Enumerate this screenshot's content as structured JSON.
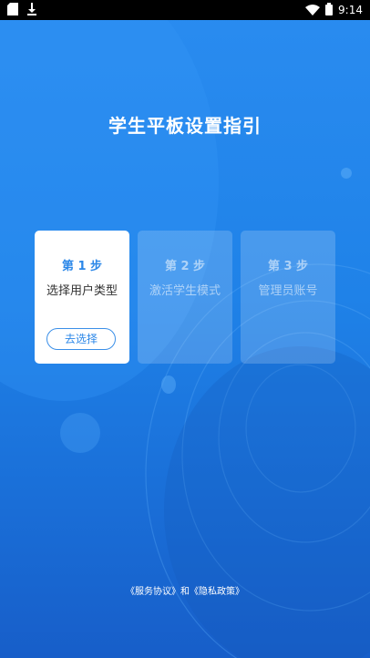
{
  "status_bar": {
    "time": "9:14",
    "left_icons": [
      "sd-card-icon",
      "download-icon"
    ],
    "right_icons": [
      "wifi-icon",
      "battery-icon"
    ]
  },
  "title": "学生平板设置指引",
  "steps": [
    {
      "step_label": "第 1 步",
      "description": "选择用户类型",
      "button_label": "去选择",
      "active": true
    },
    {
      "step_label": "第 2 步",
      "description": "激活学生模式",
      "active": false
    },
    {
      "step_label": "第 3 步",
      "description": "管理员账号",
      "active": false
    }
  ],
  "footer": {
    "service_link": "《服务协议》",
    "connector": "和",
    "privacy_link": "《隐私政策》"
  },
  "colors": {
    "background": "#1f82e8",
    "accent": "#2b87e8",
    "card_active": "#ffffff"
  }
}
